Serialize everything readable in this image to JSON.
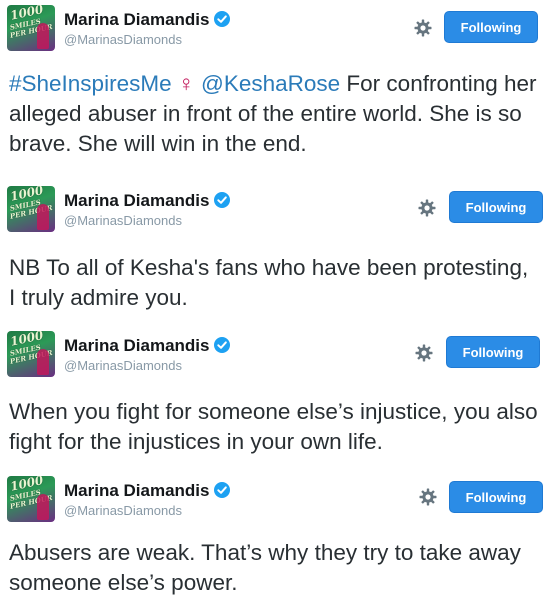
{
  "tweets": [
    {
      "display_name": "Marina Diamandis",
      "handle": "@MarinasDiamonds",
      "follow_label": "Following",
      "hashtag": "#SheInspiresMe",
      "emoji": "♀",
      "mention": "@KeshaRose",
      "text": " For confronting her alleged abuser in front of the entire world. She is so brave. She will win in the end."
    },
    {
      "display_name": "Marina Diamandis",
      "handle": "@MarinasDiamonds",
      "follow_label": "Following",
      "text": "NB To all of Kesha's fans who have been protesting, I truly admire you."
    },
    {
      "display_name": "Marina Diamandis",
      "handle": "@MarinasDiamonds",
      "follow_label": "Following",
      "text": "When you fight for someone else’s injustice, you also fight for the injustices in your own life."
    },
    {
      "display_name": "Marina Diamandis",
      "handle": "@MarinasDiamonds",
      "follow_label": "Following",
      "text": "Abusers are weak. That’s why they try to take away someone else’s power."
    }
  ],
  "avatar": {
    "line1": "1000",
    "line2": "SMILES",
    "line3": "PER HOUR"
  },
  "icons": {
    "verified": "verified-badge-icon",
    "gear": "gear-icon"
  },
  "colors": {
    "follow_button": "#2b8ce6",
    "link": "#2b7bb9",
    "verified": "#1da1f2",
    "handle": "#8899a6"
  }
}
